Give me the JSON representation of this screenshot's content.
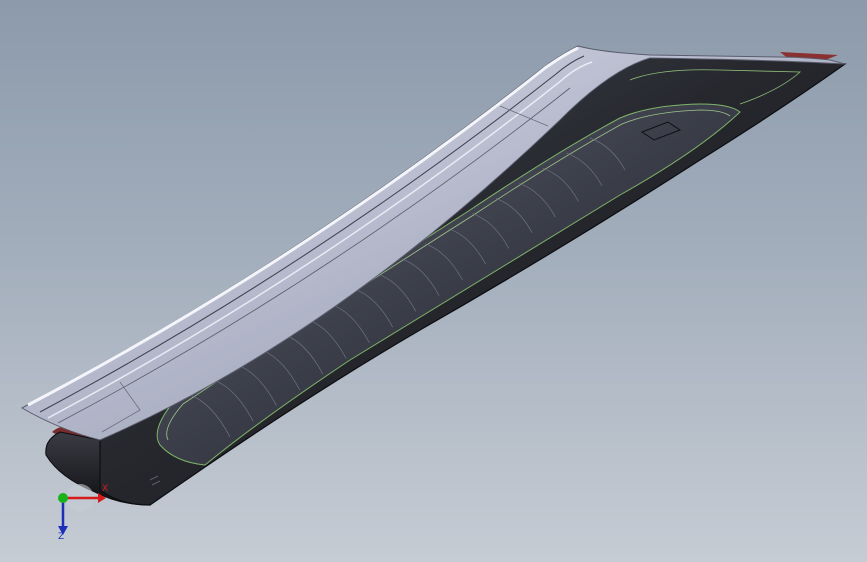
{
  "viewport": {
    "background_top": "#8c9aab",
    "background_bottom": "#c6ccd4"
  },
  "part": {
    "body_color": "#2a2c33",
    "edge_color": "#111215",
    "flange_color": "#b9bdd0",
    "highlight_color": "#eef0f8",
    "outline_color": "#7fb36a",
    "rim_color": "#8a2a2a"
  },
  "triad": {
    "icon": "coordinate-triad-icon",
    "x_label": "X",
    "z_label": "Z",
    "x_color": "#d41c1c",
    "y_color": "#19b319",
    "z_color": "#1c2fb8"
  }
}
